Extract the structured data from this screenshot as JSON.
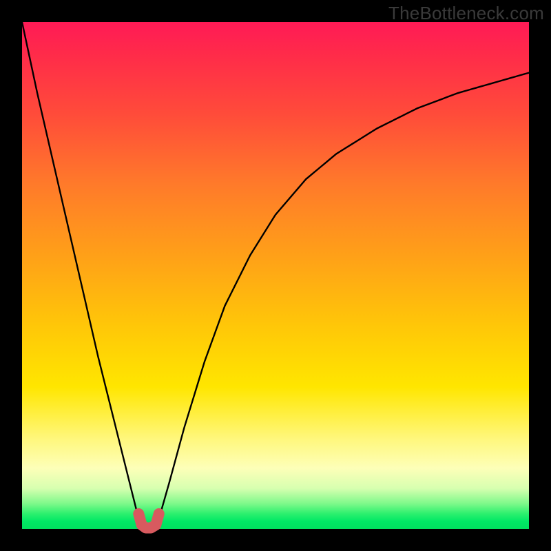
{
  "watermark": "TheBottleneck.com",
  "chart_data": {
    "type": "line",
    "title": "",
    "xlabel": "",
    "ylabel": "",
    "xlim": [
      0,
      100
    ],
    "ylim": [
      0,
      100
    ],
    "grid": false,
    "series": [
      {
        "name": "bottleneck-curve",
        "x": [
          0,
          3,
          6,
          9,
          12,
          15,
          18,
          21,
          23,
          24,
          25,
          26,
          27,
          29,
          32,
          36,
          40,
          45,
          50,
          56,
          62,
          70,
          78,
          86,
          93,
          100
        ],
        "values": [
          100,
          86,
          73,
          60,
          47,
          34,
          22,
          10,
          2,
          0,
          0,
          0,
          2,
          9,
          20,
          33,
          44,
          54,
          62,
          69,
          74,
          79,
          83,
          86,
          88,
          90
        ]
      }
    ],
    "highlight": {
      "name": "optimal-range",
      "x": [
        23.0,
        23.6,
        24.4,
        25.4,
        26.4,
        27.0
      ],
      "values": [
        3.0,
        0.8,
        0.2,
        0.2,
        0.8,
        3.0
      ],
      "color": "#d85a5f"
    },
    "background_gradient": {
      "top_color": "#ff1a56",
      "mid_color": "#ffe600",
      "bottom_color": "#00e05e"
    }
  }
}
